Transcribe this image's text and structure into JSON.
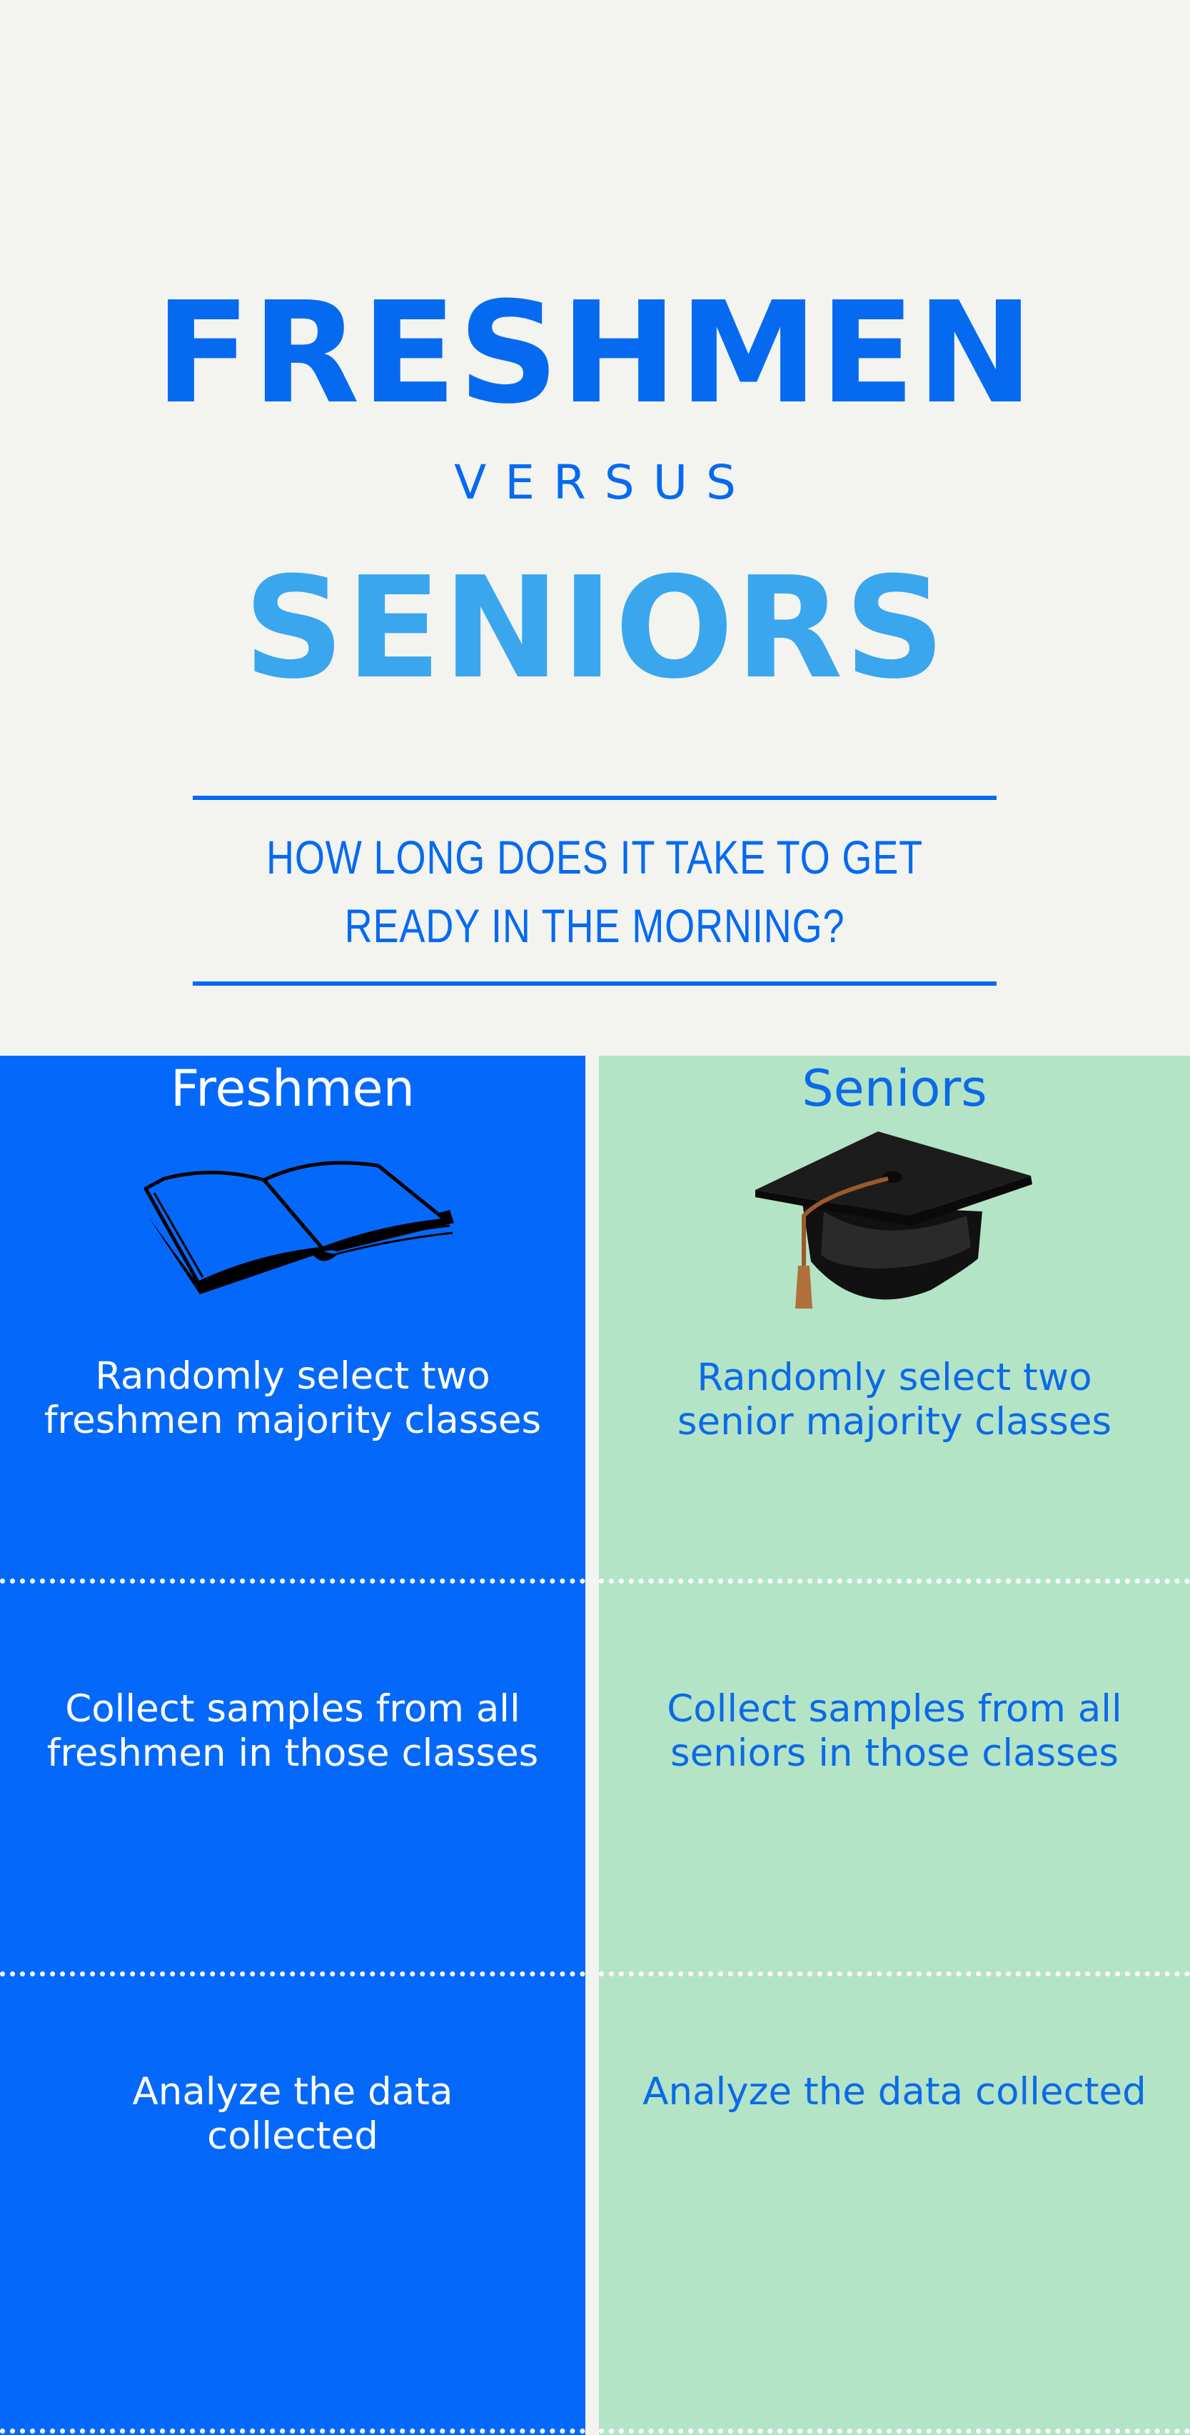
{
  "header": {
    "title_main": "FRESHMEN",
    "title_versus": "VERSUS",
    "title_seniors": "SENIORS",
    "question": "HOW LONG DOES IT TAKE TO GET READY IN THE MORNING?"
  },
  "columns": {
    "freshmen": {
      "title": "Freshmen",
      "icon": "open-book-icon",
      "steps": [
        "Randomly select two freshmen majority classes",
        "Collect samples from all freshmen in those classes",
        "Analyze the data collected"
      ]
    },
    "seniors": {
      "title": "Seniors",
      "icon": "graduation-cap-icon",
      "steps": [
        "Randomly select two senior majority classes",
        "Collect samples from all seniors in those classes",
        "Analyze the data collected"
      ]
    }
  },
  "colors": {
    "freshmen_bg": "#0469fa",
    "seniors_bg": "#b4e4c6",
    "primary_blue": "#066af1",
    "light_blue": "#3aa6ee",
    "page_bg": "#f3f4ef"
  }
}
